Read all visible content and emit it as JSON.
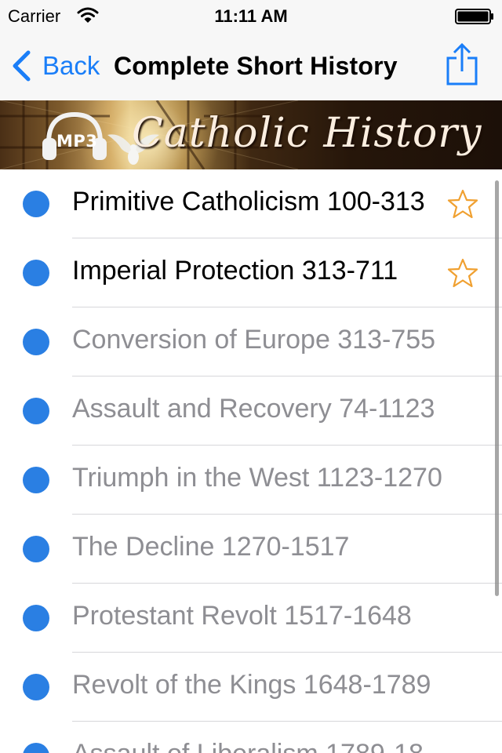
{
  "status_bar": {
    "carrier": "Carrier",
    "time": "11:11 AM"
  },
  "nav": {
    "back_label": "Back",
    "title": "Complete Short History",
    "share_icon": "share-icon",
    "accent_color": "#1a7ef8"
  },
  "banner": {
    "badge": "MP3",
    "title": "Catholic History"
  },
  "list": {
    "bullet_color": "#2a7fe3",
    "star_color": "#f0a030",
    "items": [
      {
        "label": "Primitive Catholicism 100-313",
        "starred": true
      },
      {
        "label": "Imperial Protection 313-711",
        "starred": true
      },
      {
        "label": "Conversion of Europe 313-755",
        "starred": false
      },
      {
        "label": "Assault and Recovery 74-1123",
        "starred": false
      },
      {
        "label": "Triumph in the West 1123-1270",
        "starred": false
      },
      {
        "label": "The Decline 1270-1517",
        "starred": false
      },
      {
        "label": "Protestant Revolt 1517-1648",
        "starred": false
      },
      {
        "label": "Revolt of the Kings 1648-1789",
        "starred": false
      },
      {
        "label": "Assault of Liberalism 1789-18",
        "starred": false
      }
    ]
  }
}
